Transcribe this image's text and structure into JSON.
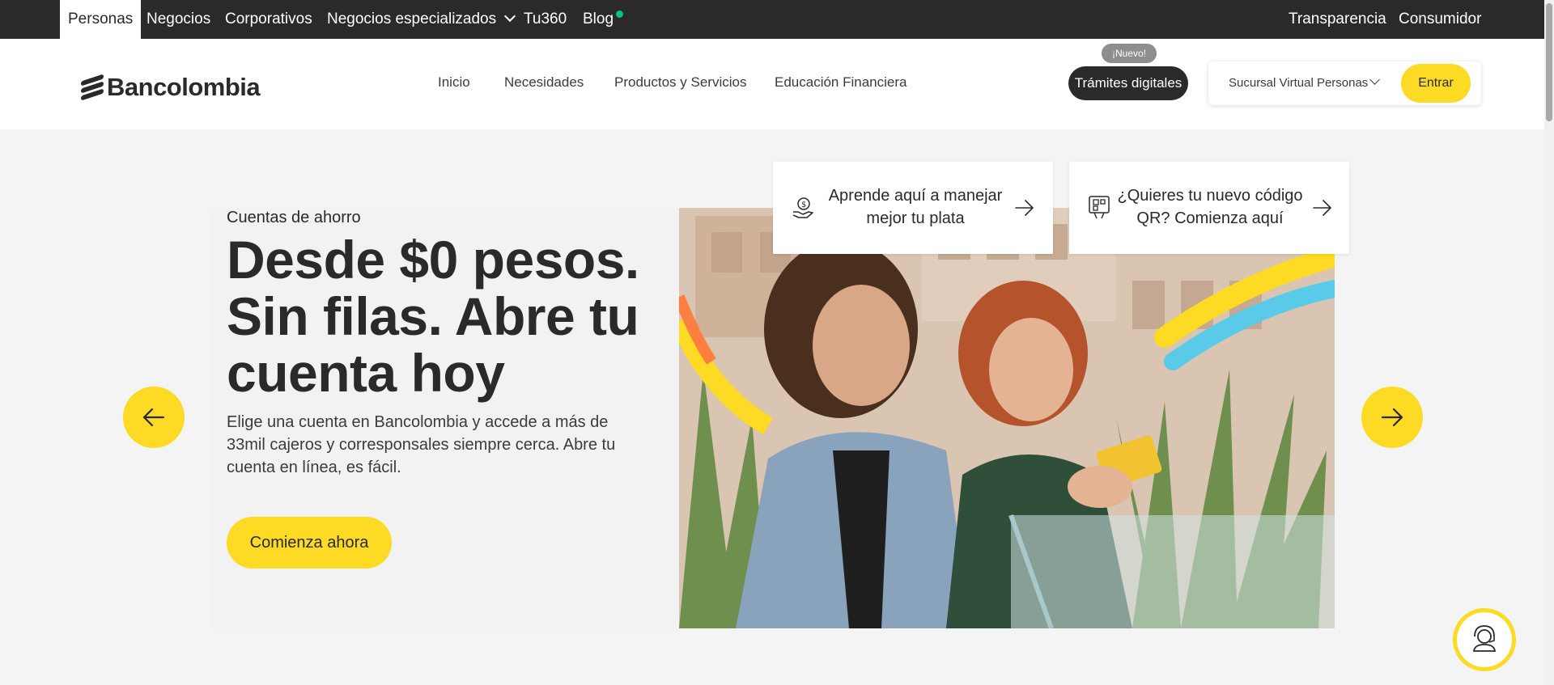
{
  "topbar": {
    "tabs": [
      "Personas",
      "Negocios",
      "Corporativos",
      "Negocios especializados",
      "Tu360",
      "Blog"
    ],
    "right_links": [
      "Transparencia",
      "Consumidor"
    ]
  },
  "header": {
    "logo_text": "Bancolombia",
    "nav": [
      "Inicio",
      "Necesidades",
      "Productos y Servicios",
      "Educación Financiera"
    ],
    "badge_new": "¡Nuevo!",
    "tramites_label": "Trámites digitales",
    "sucursal_label": "Sucursal Virtual Personas",
    "entrar_label": "Entrar"
  },
  "hero": {
    "eyebrow": "Cuentas de ahorro",
    "headline": "Desde $0 pesos. Sin filas. Abre tu cuenta hoy",
    "description": "Elige una cuenta en Bancolombia y accede a más de 33mil cajeros y corresponsales siempre cerca. Abre tu cuenta en línea, es fácil.",
    "cta_label": "Comienza ahora"
  },
  "cards": [
    {
      "line1": "Aprende aquí a manejar",
      "line2": "mejor tu plata",
      "icon": "money-hand-icon"
    },
    {
      "line1": "¿Quieres tu nuevo código",
      "line2": "QR? Comienza aquí",
      "icon": "qr-phone-icon"
    }
  ],
  "colors": {
    "brand_yellow": "#fdda24",
    "dark": "#2c2a29",
    "accent_green": "#00c389",
    "accent_blue": "#59cbe8",
    "accent_orange": "#ff7f41"
  }
}
